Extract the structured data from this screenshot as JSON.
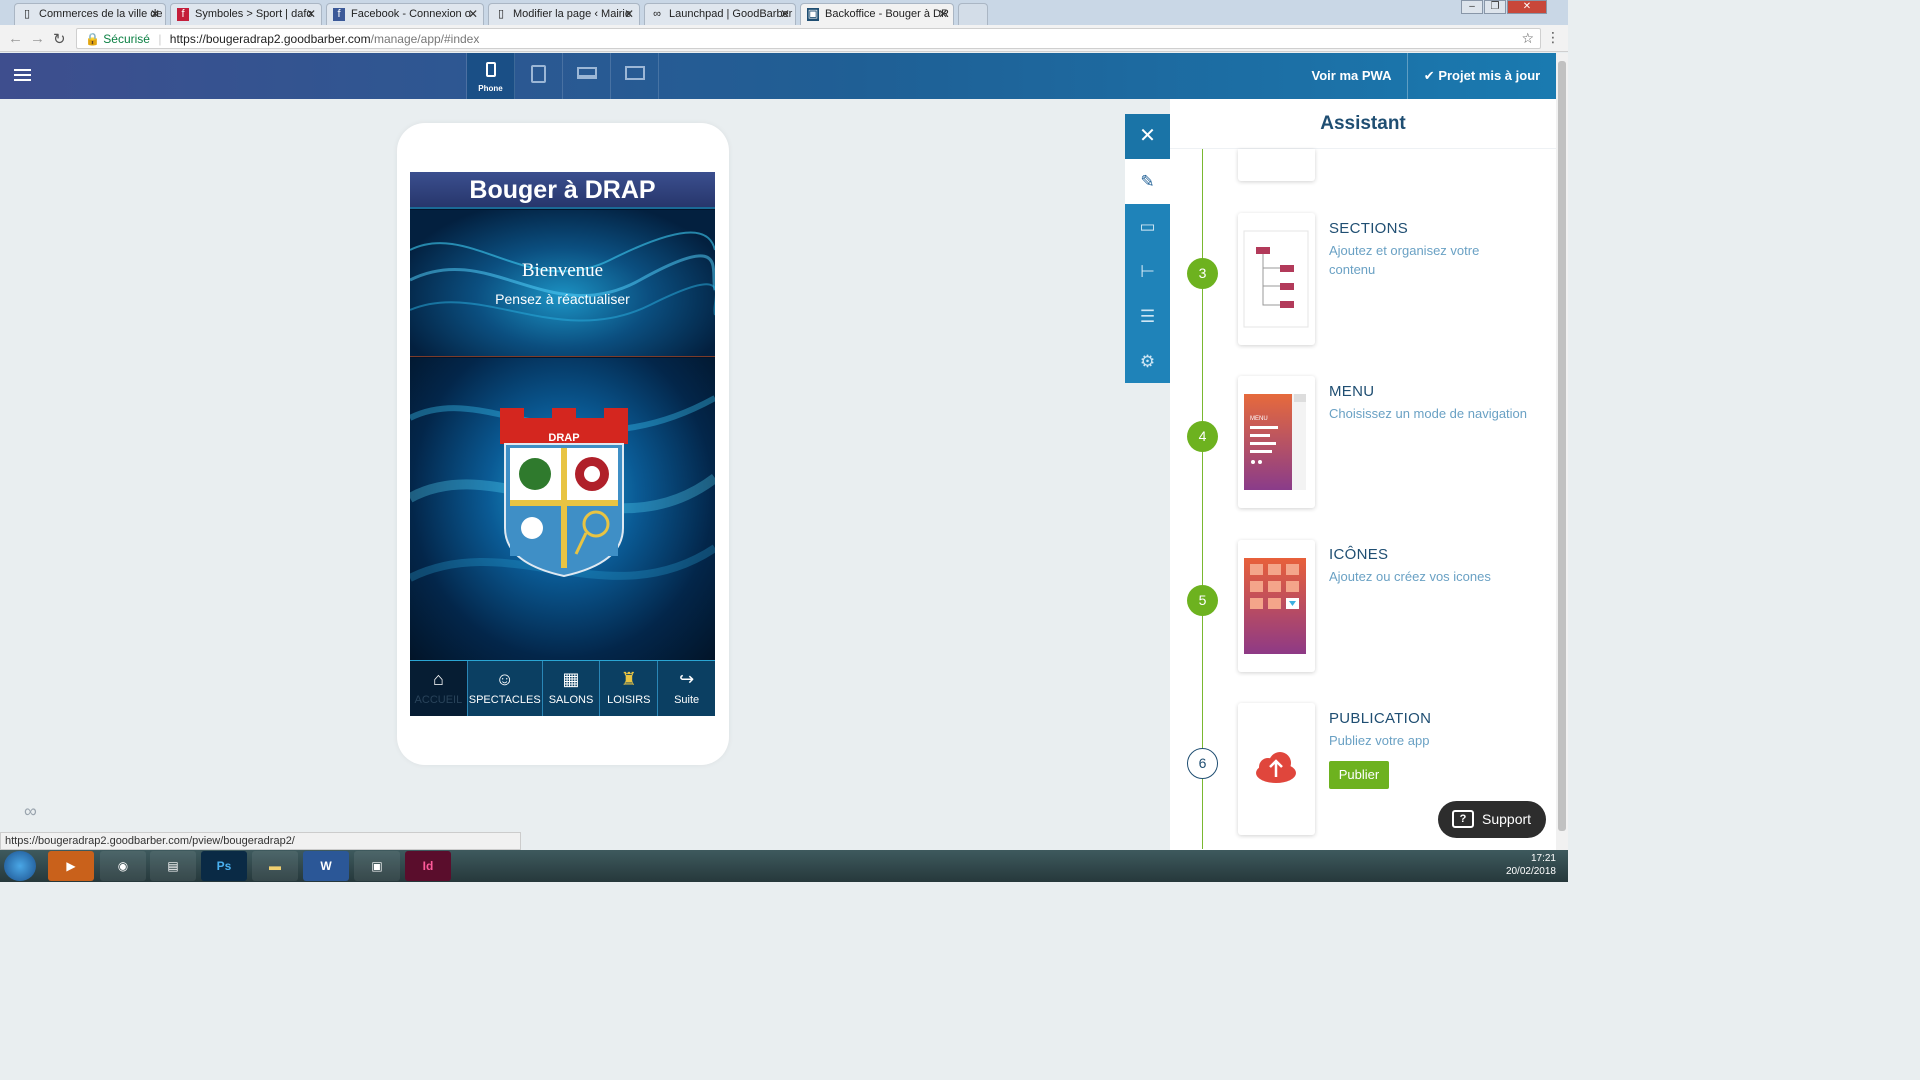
{
  "browser": {
    "tabs": [
      {
        "label": "Commerces de la ville de",
        "favicon": "doc-icon"
      },
      {
        "label": "Symboles > Sport | dafo",
        "favicon": "dafont-icon"
      },
      {
        "label": "Facebook - Connexion o",
        "favicon": "facebook-icon"
      },
      {
        "label": "Modifier la page ‹ Mairie",
        "favicon": "doc-icon"
      },
      {
        "label": "Launchpad | GoodBarber",
        "favicon": "goodbarber-icon"
      },
      {
        "label": "Backoffice - Bouger à DR",
        "favicon": "backoffice-icon"
      }
    ],
    "secure_label": "Sécurisé",
    "url_host": "https://bougeradrap2.goodbarber.com",
    "url_path": "/manage/app/#index",
    "status_url": "https://bougeradrap2.goodbarber.com/pview/bougeradrap2/"
  },
  "toolbar": {
    "devices": [
      {
        "name": "phone",
        "label": "Phone",
        "active": true
      },
      {
        "name": "tablet",
        "label": "",
        "active": false
      },
      {
        "name": "laptop",
        "label": "",
        "active": false
      },
      {
        "name": "desktop",
        "label": "",
        "active": false
      }
    ],
    "pwa_label": "Voir ma PWA",
    "update_label": "Projet mis à jour"
  },
  "preview": {
    "app_title": "Bouger à DRAP",
    "welcome": "Bienvenue",
    "subwelcome": "Pensez à réactualiser",
    "crest_label": "DRAP",
    "tabs": [
      {
        "label": "ACCUEIL",
        "icon": "home-icon",
        "selected": true
      },
      {
        "label": "SPECTACLES",
        "icon": "theater-icon",
        "selected": false
      },
      {
        "label": "SALONS",
        "icon": "calendar-icon",
        "selected": false
      },
      {
        "label": "LOISIRS",
        "icon": "leisure-icon",
        "selected": false
      },
      {
        "label": "Suite",
        "icon": "share-arrow-icon",
        "selected": false
      }
    ]
  },
  "assistant": {
    "title": "Assistant",
    "steps": [
      {
        "number": "3",
        "title": "SECTIONS",
        "desc": "Ajoutez et organisez votre contenu",
        "done": true
      },
      {
        "number": "4",
        "title": "MENU",
        "desc": "Choisissez un mode de navigation",
        "done": true
      },
      {
        "number": "5",
        "title": "ICÔNES",
        "desc": "Ajoutez ou créez vos icones",
        "done": true
      },
      {
        "number": "6",
        "title": "PUBLICATION",
        "desc": "Publiez votre app",
        "done": false
      }
    ],
    "menu_card_label": "MENU",
    "publish_label": "Publier"
  },
  "support_label": "Support",
  "taskbar": {
    "time": "17:21",
    "date": "20/02/2018",
    "apps": [
      "media-player",
      "chrome",
      "explorer",
      "Ps",
      "folder",
      "W",
      "terminal",
      "Id"
    ]
  },
  "colors": {
    "header_start": "#3e4e8e",
    "header_end": "#1a7ab0",
    "accent_green": "#6db21f",
    "sidebar_blue": "#1f83b9",
    "title_navy": "#1f4e72"
  }
}
